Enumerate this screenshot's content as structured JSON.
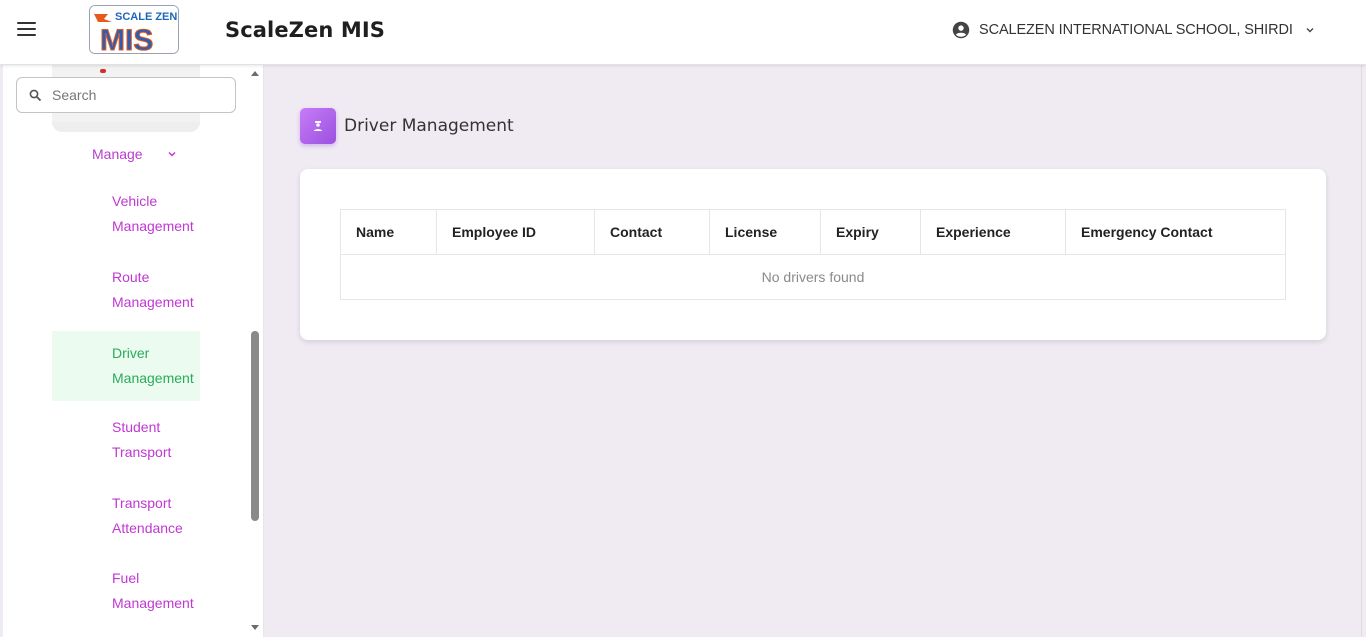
{
  "header": {
    "menu_icon": "hamburger-menu-icon",
    "logo_top_text": "SCALE ZEN",
    "logo_main_text": "MIS",
    "app_title": "ScaleZen MIS",
    "account_icon": "account-circle-icon",
    "account_name": "SCALEZEN INTERNATIONAL SCHOOL, SHIRDI",
    "account_dropdown_icon": "chevron-down-icon"
  },
  "sidebar": {
    "search": {
      "placeholder": "Search",
      "value": ""
    },
    "manage_label": "Manage",
    "items": [
      {
        "line1": "Vehicle",
        "line2": "Management",
        "active": false
      },
      {
        "line1": "Route",
        "line2": "Management",
        "active": false
      },
      {
        "line1": "Driver",
        "line2": "Management",
        "active": true
      },
      {
        "line1": "Student",
        "line2": "Transport",
        "active": false
      },
      {
        "line1": "Transport",
        "line2": "Attendance",
        "active": false
      },
      {
        "line1": "Fuel",
        "line2": "Management",
        "active": false
      }
    ]
  },
  "main": {
    "page_icon": "driver-icon",
    "page_title": "Driver Management",
    "table": {
      "columns": [
        "Name",
        "Employee ID",
        "Contact",
        "License",
        "Expiry",
        "Experience",
        "Emergency Contact"
      ],
      "empty_message": "No drivers found"
    }
  },
  "colors": {
    "sidebar_link": "#c037d3",
    "sidebar_active_text": "#2bab5a",
    "sidebar_active_bg": "#ebfbef",
    "page_bg": "#f0ebf3",
    "icon_gradient_start": "#c77df7",
    "icon_gradient_end": "#9b4fe0"
  }
}
